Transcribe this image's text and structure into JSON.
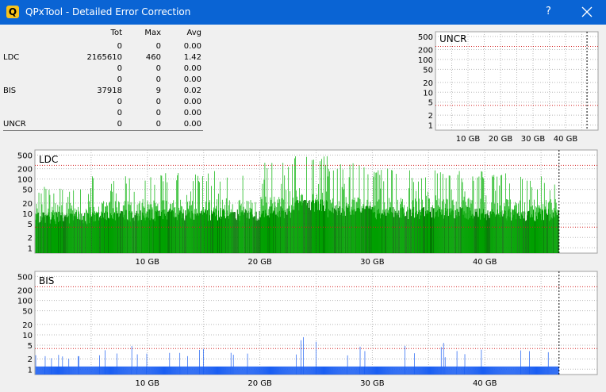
{
  "window": {
    "title": "QPxTool - Detailed Error Correction",
    "help_label": "?",
    "close_icon": "close-icon",
    "app_icon": "qpxtool-logo-icon",
    "app_icon_letter": "Q",
    "titlebar_color": "#0a64d4"
  },
  "stats": {
    "headers": {
      "tot": "Tot",
      "max": "Max",
      "avg": "Avg"
    },
    "rows": [
      {
        "label": "",
        "tot": "0",
        "max": "0",
        "avg": "0.00"
      },
      {
        "label": "LDC",
        "tot": "2165610",
        "max": "460",
        "avg": "1.42"
      },
      {
        "label": "",
        "tot": "0",
        "max": "0",
        "avg": "0.00"
      },
      {
        "label": "",
        "tot": "0",
        "max": "0",
        "avg": "0.00"
      },
      {
        "label": "BIS",
        "tot": "37918",
        "max": "9",
        "avg": "0.02"
      },
      {
        "label": "",
        "tot": "0",
        "max": "0",
        "avg": "0.00"
      },
      {
        "label": "",
        "tot": "0",
        "max": "0",
        "avg": "0.00"
      },
      {
        "label": "UNCR",
        "tot": "0",
        "max": "0",
        "avg": "0.00"
      }
    ]
  },
  "chart_data": [
    {
      "id": "uncr",
      "type": "bar",
      "title": "UNCR",
      "y_scale": "log",
      "ylim": [
        0.7,
        700
      ],
      "yticks": [
        "500",
        "200",
        "100",
        "50",
        "20",
        "10",
        "5",
        "2",
        "1"
      ],
      "ytick_values": [
        500,
        200,
        100,
        50,
        20,
        10,
        5,
        2,
        1
      ],
      "xticks": [
        "10 GB",
        "20 GB",
        "30 GB",
        "40 GB"
      ],
      "xtick_values": [
        10,
        20,
        30,
        40
      ],
      "xlim": [
        0,
        50
      ],
      "disc_end_gb": 46.6,
      "red_lines": [
        250,
        4
      ],
      "series": [
        {
          "color": "#00a000",
          "values": []
        }
      ]
    },
    {
      "id": "ldc",
      "type": "bar",
      "title": "LDC",
      "y_scale": "log",
      "ylim": [
        0.7,
        700
      ],
      "yticks": [
        "500",
        "200",
        "100",
        "50",
        "20",
        "10",
        "5",
        "2",
        "1"
      ],
      "ytick_values": [
        500,
        200,
        100,
        50,
        20,
        10,
        5,
        2,
        1
      ],
      "xticks": [
        "10 GB",
        "20 GB",
        "30 GB",
        "40 GB"
      ],
      "xtick_values": [
        10,
        20,
        30,
        40
      ],
      "xlim": [
        0,
        50
      ],
      "disc_end_gb": 46.6,
      "red_lines": [
        250,
        4
      ],
      "colors": {
        "spike": "#00b000",
        "base": "#007800"
      },
      "segments": [
        {
          "x0": 0.0,
          "x1": 5.0,
          "base": 8,
          "peak": 60
        },
        {
          "x0": 5.0,
          "x1": 10.0,
          "base": 9,
          "peak": 120
        },
        {
          "x0": 10.0,
          "x1": 15.0,
          "base": 10,
          "peak": 160
        },
        {
          "x0": 15.0,
          "x1": 20.0,
          "base": 10,
          "peak": 180
        },
        {
          "x0": 20.0,
          "x1": 23.0,
          "base": 12,
          "peak": 300
        },
        {
          "x0": 23.0,
          "x1": 26.0,
          "base": 18,
          "peak": 460
        },
        {
          "x0": 26.0,
          "x1": 30.0,
          "base": 12,
          "peak": 300
        },
        {
          "x0": 30.0,
          "x1": 35.0,
          "base": 11,
          "peak": 200
        },
        {
          "x0": 35.0,
          "x1": 40.0,
          "base": 11,
          "peak": 180
        },
        {
          "x0": 40.0,
          "x1": 46.6,
          "base": 10,
          "peak": 150
        }
      ]
    },
    {
      "id": "bis",
      "type": "bar",
      "title": "BIS",
      "y_scale": "log",
      "ylim": [
        0.7,
        700
      ],
      "yticks": [
        "500",
        "200",
        "100",
        "50",
        "20",
        "10",
        "5",
        "2",
        "1"
      ],
      "ytick_values": [
        500,
        200,
        100,
        50,
        20,
        10,
        5,
        2,
        1
      ],
      "xticks": [
        "10 GB",
        "20 GB",
        "30 GB",
        "40 GB"
      ],
      "xtick_values": [
        10,
        20,
        30,
        40
      ],
      "xlim": [
        0,
        50
      ],
      "disc_end_gb": 46.6,
      "red_lines": [
        250,
        4
      ],
      "colors": {
        "spike": "#1a5ef2",
        "base": "#1a5ef2"
      },
      "segments": [
        {
          "x0": 0.0,
          "x1": 5.0,
          "base": 1,
          "peak": 3
        },
        {
          "x0": 5.0,
          "x1": 10.0,
          "base": 1,
          "peak": 5
        },
        {
          "x0": 10.0,
          "x1": 15.0,
          "base": 1,
          "peak": 4
        },
        {
          "x0": 15.0,
          "x1": 20.0,
          "base": 1,
          "peak": 4
        },
        {
          "x0": 20.0,
          "x1": 23.0,
          "base": 1,
          "peak": 6
        },
        {
          "x0": 23.0,
          "x1": 26.0,
          "base": 1,
          "peak": 9
        },
        {
          "x0": 26.0,
          "x1": 30.0,
          "base": 1,
          "peak": 5
        },
        {
          "x0": 30.0,
          "x1": 35.0,
          "base": 1,
          "peak": 5
        },
        {
          "x0": 35.0,
          "x1": 40.0,
          "base": 1,
          "peak": 6
        },
        {
          "x0": 40.0,
          "x1": 46.6,
          "base": 1,
          "peak": 5
        }
      ]
    }
  ]
}
